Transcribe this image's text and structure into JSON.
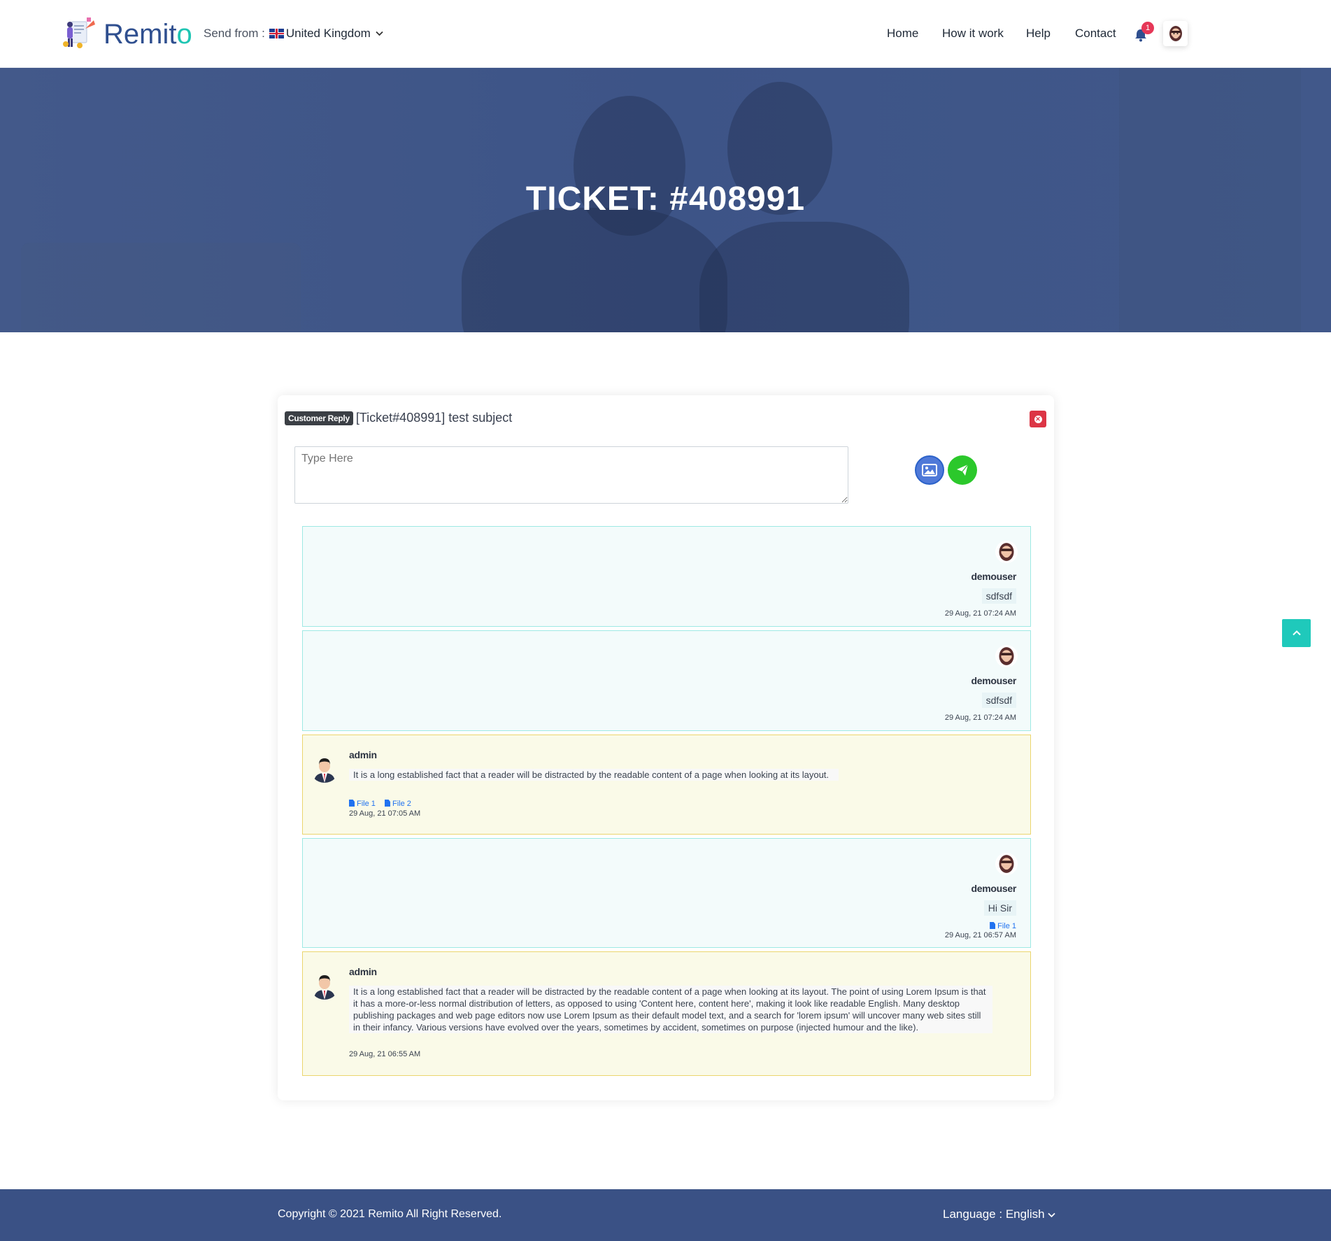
{
  "header": {
    "logo_text_main": "Remit",
    "logo_text_accent": "o",
    "send_from_label": "Send from :",
    "send_from_country": "United Kingdom",
    "nav": [
      {
        "label": "Home"
      },
      {
        "label": "How it work"
      },
      {
        "label": "Help"
      },
      {
        "label": "Contact"
      }
    ],
    "notification_count": "1"
  },
  "hero": {
    "title": "TICKET: #408991"
  },
  "ticket": {
    "badge": "Customer Reply",
    "subject": "[Ticket#408991] test subject",
    "reply_placeholder": "Type Here"
  },
  "messages": [
    {
      "type": "user",
      "name": "demouser",
      "text": "sdfsdf",
      "time": "29 Aug, 21 07:24 AM"
    },
    {
      "type": "user",
      "name": "demouser",
      "text": "sdfsdf",
      "time": "29 Aug, 21 07:24 AM"
    },
    {
      "type": "admin",
      "name": "admin",
      "text": "It is a long established fact that a reader will be distracted by the readable content of a page when looking at its layout.",
      "files": [
        "File 1",
        "File 2"
      ],
      "time": "29 Aug, 21 07:05 AM"
    },
    {
      "type": "user",
      "name": "demouser",
      "text": "Hi Sir",
      "files": [
        "File 1"
      ],
      "time": "29 Aug, 21 06:57 AM"
    },
    {
      "type": "admin",
      "name": "admin",
      "text": "It is a long established fact that a reader will be distracted by the readable content of a page when looking at its layout. The point of using Lorem Ipsum is that it has a more-or-less normal distribution of letters, as opposed to using 'Content here, content here', making it look like readable English. Many desktop publishing packages and web page editors now use Lorem Ipsum as their default model text, and a search for 'lorem ipsum' will uncover many web sites still in their infancy. Various versions have evolved over the years, sometimes by accident, sometimes on purpose (injected humour and the like).",
      "time": "29 Aug, 21 06:55 AM"
    }
  ],
  "footer": {
    "copyright": "Copyright © 2021 Remito All Right Reserved.",
    "language_label": "Language :",
    "language_value": "English"
  },
  "colors": {
    "brand": "#2f4f8f",
    "accent": "#1fc5b3",
    "hero_bg": "#405a8a",
    "footer_bg": "#3a5185",
    "danger": "#dc3545",
    "send": "#2bc82b"
  }
}
